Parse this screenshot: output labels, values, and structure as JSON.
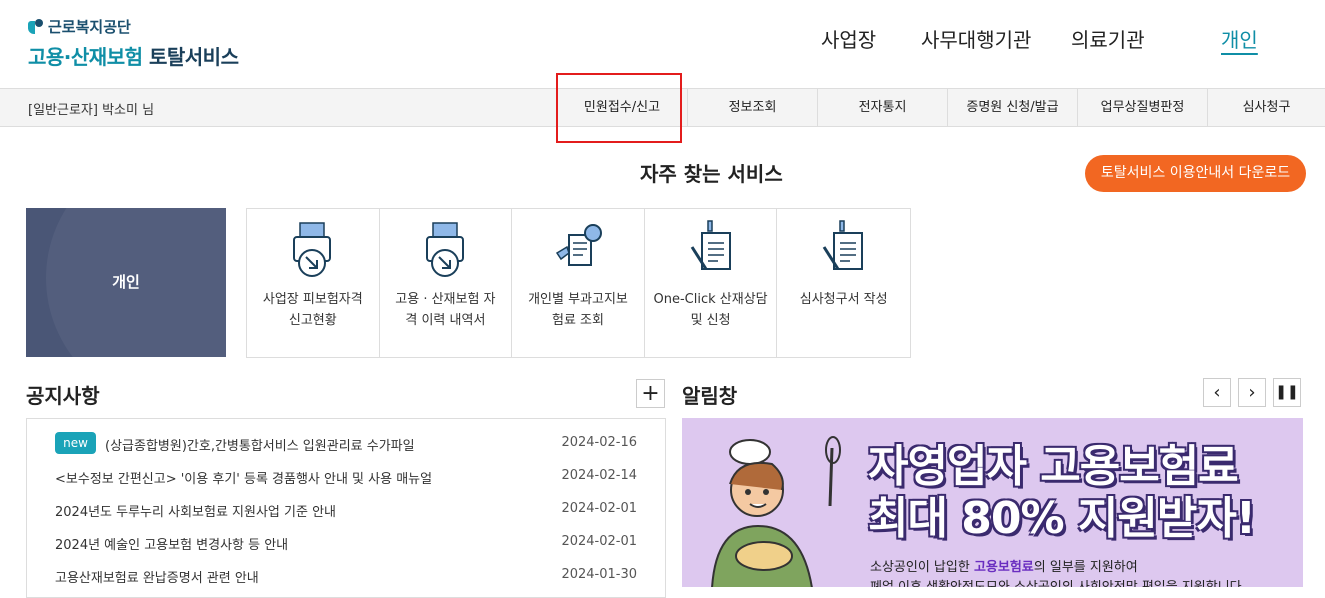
{
  "logo": {
    "org": "근로복지공단",
    "service_a": "고용·산재보험",
    "service_b": "토탈서비스"
  },
  "topnav": {
    "business": "사업장",
    "agency": "사무대행기관",
    "medical": "의료기관",
    "personal": "개인"
  },
  "subbar": {
    "user": "[일반근로자] 박소미 님",
    "menu": [
      "민원접수/신고",
      "정보조회",
      "전자통지",
      "증명원 신청/발급",
      "업무상질병판정",
      "심사청구"
    ]
  },
  "frequent": {
    "title": "자주 찾는 서비스",
    "guide_button": "토탈서비스 이용안내서 다운로드",
    "card": "개인",
    "services": [
      {
        "label1": "사업장 피보험자격",
        "label2": "신고현황",
        "icon": "document-tray-icon"
      },
      {
        "label1": "고용 · 산재보험 자",
        "label2": "격 이력 내역서",
        "icon": "document-tray-icon"
      },
      {
        "label1": "개인별 부과고지보",
        "label2": "험료 조회",
        "icon": "receipt-search-icon"
      },
      {
        "label1": "One-Click 산재상담",
        "label2": "및 신청",
        "icon": "pen-document-icon"
      },
      {
        "label1": "심사청구서 작성",
        "label2": "",
        "icon": "pen-document-icon"
      }
    ]
  },
  "notices": {
    "title": "공지사항",
    "badge": "new",
    "items": [
      {
        "title": "(상급종합병원)간호,간병통합서비스 입원관리료 수가파일",
        "date": "2024-02-16"
      },
      {
        "title": "<보수정보 간편신고> '이용 후기' 등록 경품행사 안내 및 사용 매뉴얼",
        "date": "2024-02-14"
      },
      {
        "title": "2024년도 두루누리 사회보험료 지원사업 기준 안내",
        "date": "2024-02-01"
      },
      {
        "title": "2024년 예술인 고용보험 변경사항 등 안내",
        "date": "2024-02-01"
      },
      {
        "title": "고용산재보험료 완납증명서 관련 안내",
        "date": "2024-01-30"
      }
    ]
  },
  "alerts": {
    "title": "알림창",
    "banner_line1": "자영업자 고용보험료",
    "banner_line2": "최대 80% 지원받자!",
    "banner_sub_a": "소상공인이 납입한 ",
    "banner_sub_hl": "고용보험료",
    "banner_sub_b": "의 일부를 지원하여",
    "banner_sub2": "폐업 이후 생활안정도모와 소상공인의 사회안전망 편입을 지원합니다"
  }
}
